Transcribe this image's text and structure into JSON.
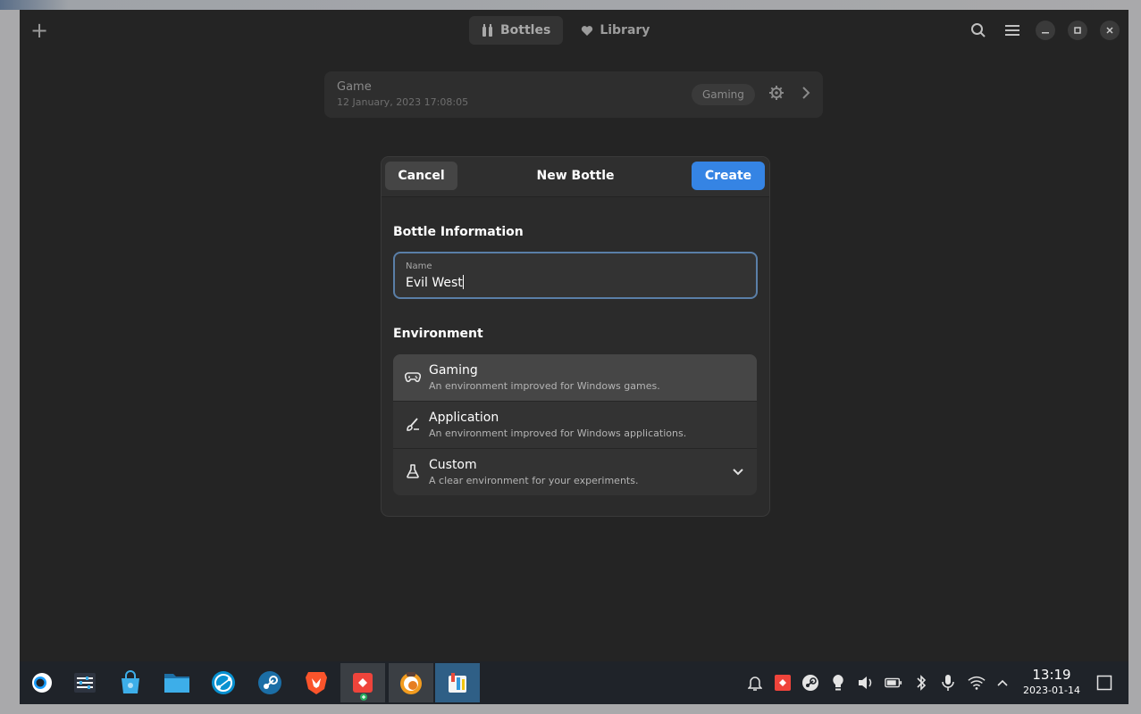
{
  "headerbar": {
    "tabs": [
      {
        "label": "Bottles",
        "icon": "bottles-icon",
        "active": true
      },
      {
        "label": "Library",
        "icon": "heart-icon",
        "active": false
      }
    ],
    "icons": [
      "add-icon",
      "search-icon",
      "menu-icon",
      "minimize-icon",
      "maximize-icon",
      "close-icon"
    ]
  },
  "bottle_list": [
    {
      "name": "Game",
      "date": "12 January, 2023 17:08:05",
      "environment": "Gaming"
    }
  ],
  "dialog": {
    "cancel_label": "Cancel",
    "title": "New Bottle",
    "create_label": "Create",
    "info_section": "Bottle Information",
    "name_label": "Name",
    "name_value": "Evil West",
    "env_section": "Environment",
    "environments": [
      {
        "title": "Gaming",
        "subtitle": "An environment improved for Windows games.",
        "icon": "gamepad-icon",
        "selected": true
      },
      {
        "title": "Application",
        "subtitle": "An environment improved for Windows applications.",
        "icon": "brush-icon",
        "selected": false
      },
      {
        "title": "Custom",
        "subtitle": "A clear environment for your experiments.",
        "icon": "flask-icon",
        "selected": false
      }
    ]
  },
  "taskbar": {
    "apps": [
      "steamos-menu-icon",
      "settings-icon",
      "discover-store-icon",
      "file-manager-icon",
      "syncthing-icon",
      "steam-icon",
      "brave-browser-icon",
      "anydesk-icon",
      "bottles-app-icon",
      "app-icon"
    ],
    "tray": [
      "notifications-icon",
      "anydesk-tray-icon",
      "steam-tray-icon",
      "lightbulb-icon",
      "volume-icon",
      "battery-icon",
      "bluetooth-icon",
      "microphone-icon",
      "wifi-icon",
      "expand-tray-icon"
    ],
    "time": "13:19",
    "date": "2023-01-14"
  },
  "colors": {
    "accent": "#3584e4",
    "window_bg": "#242424",
    "dialog_bg": "#2b2b2b",
    "taskbar_bg": "#1f2329"
  }
}
